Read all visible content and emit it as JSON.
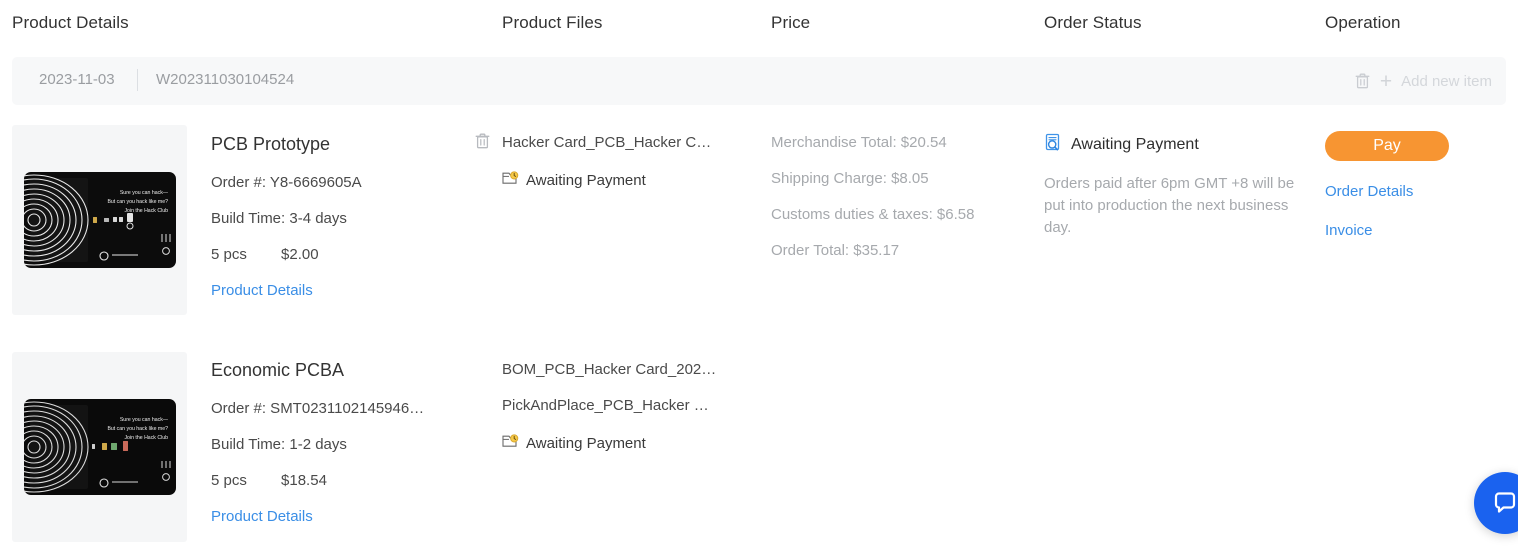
{
  "columns": {
    "product_details": "Product Details",
    "product_files": "Product Files",
    "price": "Price",
    "order_status": "Order Status",
    "operation": "Operation"
  },
  "order_band": {
    "date": "2023-11-03",
    "order_number": "W202311030104524",
    "delete_icon": "trash-icon",
    "plus_icon": "plus-icon",
    "add_new_item": "Add new item"
  },
  "rows": [
    {
      "thumbnail_alt": "black pcb hacker card",
      "title": "PCB Prototype",
      "delete_icon": "trash-icon",
      "order_no": "Order #: Y8-6669605A",
      "build_time": "Build Time: 3-4 days",
      "qty": "5 pcs",
      "unit_price": "$2.00",
      "details_link": "Product Details",
      "files": [
        "Hacker Card_PCB_Hacker C…"
      ],
      "file_status": "Awaiting Payment",
      "file_status_icon": "pending-file-icon",
      "price_lines": [
        "Merchandise Total: $20.54",
        "Shipping Charge: $8.05",
        "Customs duties & taxes: $6.58",
        "Order Total: $35.17"
      ],
      "status_icon": "document-search-icon",
      "status_label": "Awaiting Payment",
      "status_note": "Orders paid after 6pm GMT +8 will be put into production the next business day.",
      "pay_button": "Pay",
      "order_details_link": "Order Details",
      "invoice_link": "Invoice"
    },
    {
      "thumbnail_alt": "black pcb hacker card assembled",
      "title": "Economic PCBA",
      "order_no": "Order #: SMT0231102145946…",
      "build_time": "Build Time: 1-2 days",
      "qty": "5 pcs",
      "unit_price": "$18.54",
      "details_link": "Product Details",
      "files": [
        "BOM_PCB_Hacker Card_202…",
        "PickAndPlace_PCB_Hacker …"
      ],
      "file_status": "Awaiting Payment",
      "file_status_icon": "pending-file-icon"
    }
  ],
  "chat_widget": {
    "icon": "chat-bubble-icon"
  },
  "colors": {
    "accent_link": "#3a8ee6",
    "pay_button": "#f79532",
    "band_background": "#f7f8f9",
    "muted_text": "#a6a9ad",
    "chat_blue": "#1a62ef"
  },
  "card_art": {
    "line1": "Sure you can hack—",
    "line2": "But can you hack like me?",
    "line3": "Join the Hack Club"
  }
}
